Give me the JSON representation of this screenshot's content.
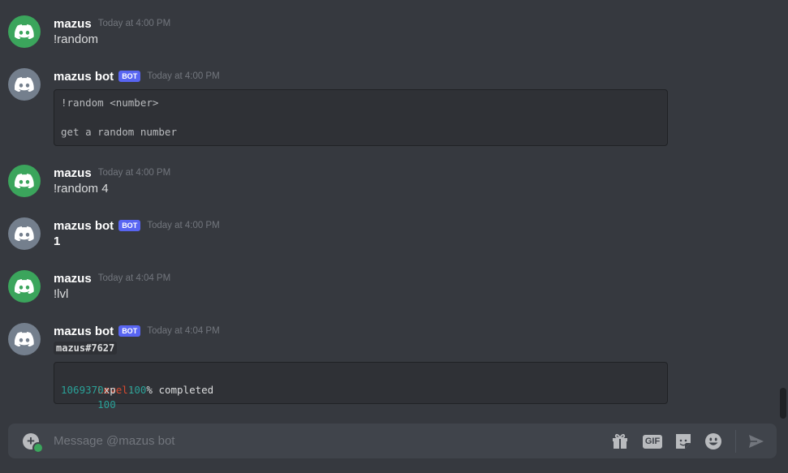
{
  "colors": {
    "background": "#36393f",
    "user_avatar": "#3ba55c",
    "bot_avatar": "#747f8d",
    "bot_tag": "#5865f2",
    "level_label": "#dc4a2f",
    "value_teal": "#2aa198"
  },
  "messages": [
    {
      "username": "mazus",
      "timestamp": "Today at 4:00 PM",
      "text": "!random",
      "avatar_icon": "discord-logo-icon"
    },
    {
      "username": "mazus bot",
      "bot_tag": "BOT",
      "timestamp": "Today at 4:00 PM",
      "code_lines": [
        "!random <number>",
        "",
        "get a random number"
      ],
      "avatar_icon": "discord-logo-icon"
    },
    {
      "username": "mazus",
      "timestamp": "Today at 4:00 PM",
      "text": "!random 4",
      "avatar_icon": "discord-logo-icon"
    },
    {
      "username": "mazus bot",
      "bot_tag": "BOT",
      "timestamp": "Today at 4:00 PM",
      "text": "1",
      "avatar_icon": "discord-logo-icon"
    },
    {
      "username": "mazus",
      "timestamp": "Today at 4:04 PM",
      "text": "!lvl",
      "avatar_icon": "discord-logo-icon"
    },
    {
      "username": "mazus bot",
      "bot_tag": "BOT",
      "timestamp": "Today at 4:04 PM",
      "inline_code": "mazus#7627",
      "level_block": {
        "level_label": "Level:",
        "level_value": "100",
        "xp_value": "1069370",
        "xp_unit": "xp",
        "percent_value": "100",
        "percent_suffix": "% completed"
      },
      "avatar_icon": "discord-logo-icon"
    }
  ],
  "composer": {
    "placeholder": "Message @mazus bot",
    "attach_icon": "plus-circle-icon",
    "tools": [
      {
        "icon": "gift-icon"
      },
      {
        "icon": "gif-icon",
        "label": "GIF"
      },
      {
        "icon": "sticker-icon"
      },
      {
        "icon": "emoji-icon"
      },
      {
        "icon": "send-icon"
      }
    ]
  }
}
